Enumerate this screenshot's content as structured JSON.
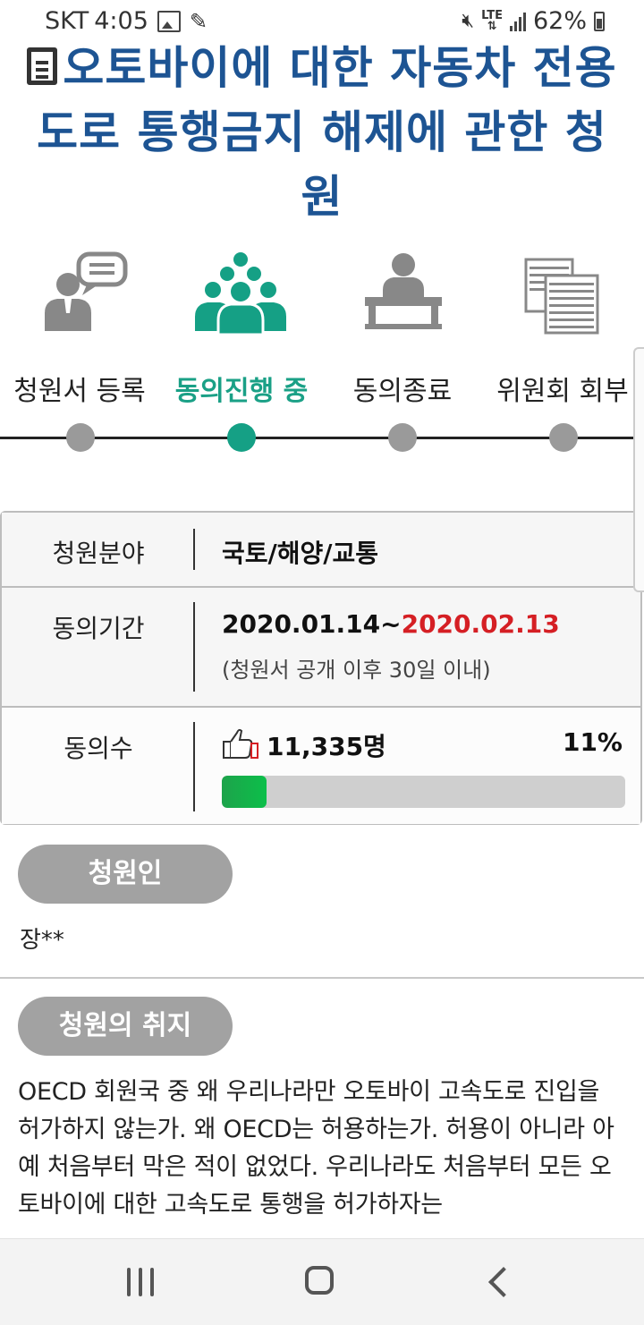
{
  "status_bar": {
    "carrier": "SKT",
    "time": "4:05",
    "network": "LTE",
    "battery": "62%"
  },
  "title": "오토바이에 대한 자동차 전용도로 통행금지 해제에 관한 청원",
  "steps": [
    {
      "label": "청원서 등록",
      "icon": "person-speech-icon",
      "active": false
    },
    {
      "label": "동의진행 중",
      "icon": "group-people-icon",
      "active": true
    },
    {
      "label": "동의종료",
      "icon": "person-podium-icon",
      "active": false
    },
    {
      "label": "위원회 회부",
      "icon": "document-stack-icon",
      "active": false
    }
  ],
  "info": {
    "category_label": "청원분야",
    "category_value": "국토/해양/교통",
    "period_label": "동의기간",
    "period_start": "2020.01.14~",
    "period_end": "2020.02.13",
    "period_note": "(청원서 공개 이후 30일 이내)",
    "agree_label": "동의수",
    "agree_count": "11,335명",
    "agree_percent": "11%",
    "agree_progress": 0.11
  },
  "petitioner": {
    "heading": "청원인",
    "name": "장**"
  },
  "purpose": {
    "heading": "청원의 취지",
    "text": "OECD 회원국 중 왜 우리나라만 오토바이 고속도로 진입을 허가하지 않는가. 왜 OECD는 허용하는가. 허용이 아니라 아예 처음부터 막은 적이 없었다.  우리나라도 처음부터 모든 오토바이에 대한 고속도로 통행을 허가하자는"
  },
  "colors": {
    "title": "#1d5493",
    "active": "#15a085",
    "date_end": "#d51f24",
    "progress": "#1da34b"
  }
}
